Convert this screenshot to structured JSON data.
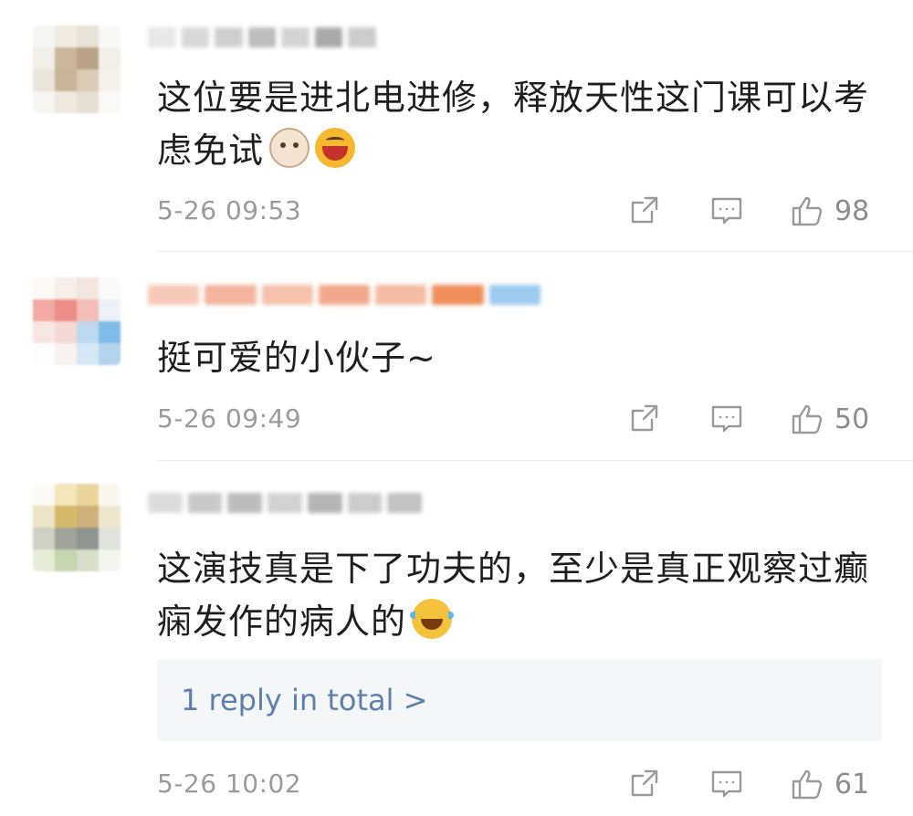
{
  "comments": [
    {
      "avatar_colors": [
        "#f6f6f2",
        "#eeeae0",
        "#e8e2d8",
        "#f8f8f6",
        "#f1eee8",
        "#cbb79d",
        "#b8a386",
        "#f2efe9",
        "#ebe5dc",
        "#c7b69a",
        "#d9cbb5",
        "#f4f1ec",
        "#f7f6f3",
        "#eee8df",
        "#e6dfd4",
        "#f9f9f7"
      ],
      "username_colors": [
        "#e8e8e8",
        "#d8d8d8",
        "#cfcfcf",
        "#bdbdbd",
        "#d4d4d4",
        "#a9a9a9",
        "#cccccc"
      ],
      "text": "这位要是进北电进修，释放天性这门课可以考虑免试",
      "emojis": [
        "cow-face-emoji",
        "grinning-face-emoji"
      ],
      "time": "5-26 09:53",
      "likes": "98"
    },
    {
      "avatar_colors": [
        "#fbf8f6",
        "#f7eeea",
        "#f3e6e1",
        "#fafafa",
        "#f2aaa3",
        "#ec8d86",
        "#f4bdb7",
        "#ecf2f7",
        "#f5e6e3",
        "#f3d9d5",
        "#bcd9ef",
        "#7fbbe9",
        "#fdfdfd",
        "#f8f3f1",
        "#d7e8f5",
        "#b2d4ef"
      ],
      "username_colors": [
        "#f7c9b8",
        "#f4b59c",
        "#f6c2ab",
        "#f2a98b",
        "#f5bca3",
        "#f08f5c",
        "#9ccbf0"
      ],
      "text": "挺可爱的小伙子~",
      "emojis": [],
      "time": "5-26 09:49",
      "likes": "50"
    },
    {
      "avatar_colors": [
        "#fbfaf4",
        "#f3e6b9",
        "#e8d69d",
        "#f9f7ee",
        "#ece4c6",
        "#d6b86c",
        "#cdb07a",
        "#eee7cf",
        "#cfd0c4",
        "#a0a49a",
        "#8e948f",
        "#e0e3dc",
        "#e6ecd6",
        "#c5d4b1",
        "#d7dec9",
        "#f3f5ee"
      ],
      "username_colors": [
        "#dcdcdc",
        "#c8c8c8",
        "#bcbcbc",
        "#d2d2d2",
        "#b4b4b4",
        "#cccccc",
        "#c2c2c2"
      ],
      "text": "这演技真是下了功夫的，至少是真正观察过癫痫发作的病人的",
      "emojis": [
        "laughing-crying-emoji"
      ],
      "replies_label": "1 reply in total >",
      "time": "5-26 10:02",
      "likes": "61"
    }
  ]
}
